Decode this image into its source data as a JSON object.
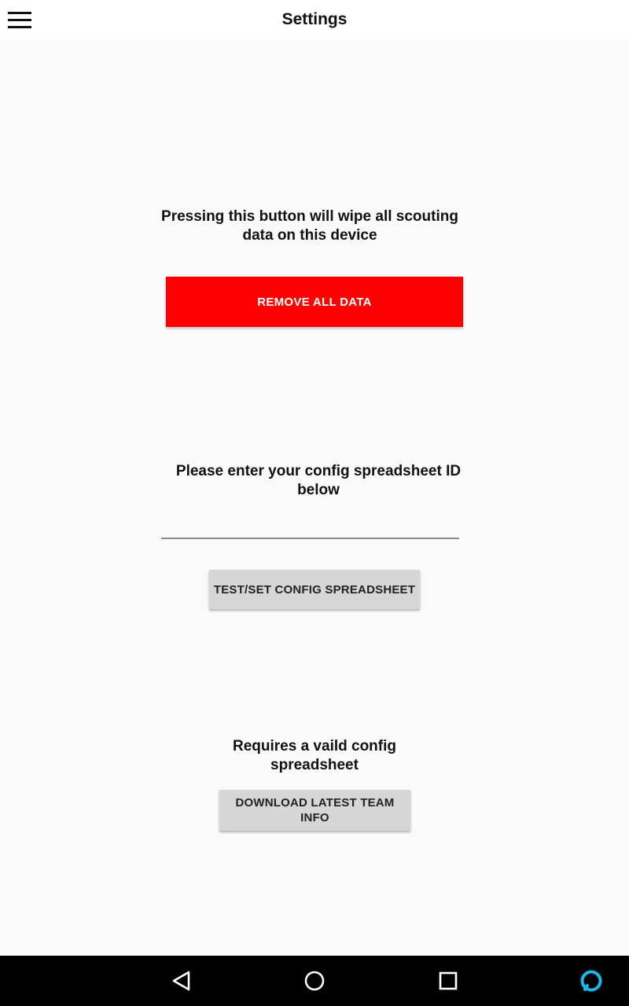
{
  "app_bar": {
    "title": "Settings",
    "menu_icon": "hamburger-menu-icon"
  },
  "wipe_section": {
    "message": "Pressing this button will wipe all scouting data on this device",
    "button_label": "REMOVE ALL DATA",
    "button_color": "#ff0000"
  },
  "config_section": {
    "message": "Please enter your config spreadsheet ID below",
    "input_value": "",
    "button_label": "TEST/SET CONFIG SPREADSHEET"
  },
  "download_section": {
    "message": "Requires a vaild config spreadsheet",
    "button_label": "DOWNLOAD LATEST TEAM INFO"
  },
  "nav_bar": {
    "icons": [
      "back-icon",
      "home-icon",
      "recents-icon",
      "alexa-icon"
    ],
    "alexa_color": "#1ab7ea"
  }
}
